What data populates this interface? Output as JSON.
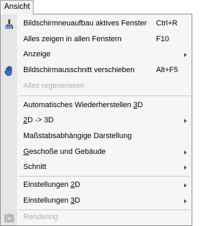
{
  "menubar": {
    "tab_label": "Ansicht"
  },
  "menu": {
    "items": [
      {
        "label": "Bildschirmneuaufbau aktives Fenster",
        "shortcut": "Ctrl+R",
        "icon": "brush-icon"
      },
      {
        "label": "Alles zeigen in allen Fenstern",
        "shortcut": "F10"
      },
      {
        "label": "Anzeige",
        "submenu": true
      },
      {
        "label": "Bildschirmausschnitt verschieben",
        "shortcut": "Alt+F5",
        "icon": "hand-pan-icon"
      },
      {
        "label": "Alles regenerieren",
        "disabled": true
      },
      {
        "label_pre": "Automatisches Wiederherstellen ",
        "label_u": "3",
        "label_post": "D"
      },
      {
        "label_pre": "",
        "label_u": "2",
        "label_post": "D -> 3D",
        "submenu": true
      },
      {
        "label": "Maßstabsabhängige Darstellung"
      },
      {
        "label_pre": "",
        "label_u": "G",
        "label_post": "eschoße und Gebäude",
        "submenu": true
      },
      {
        "label": "Schnitt",
        "submenu": true
      },
      {
        "label_pre": "Einstellungen ",
        "label_u": "2",
        "label_post": "D",
        "submenu": true
      },
      {
        "label_pre": "Einstellungen ",
        "label_u": "3",
        "label_post": "D",
        "submenu": true
      },
      {
        "label": "Rendering",
        "disabled": true,
        "icon": "render-camera-icon"
      }
    ]
  },
  "colors": {
    "menu_bg": "#f6f6f6",
    "icon_strip": "#e6e6e6",
    "disabled_text": "#b1b1b1",
    "separator": "#c8c8c8"
  }
}
